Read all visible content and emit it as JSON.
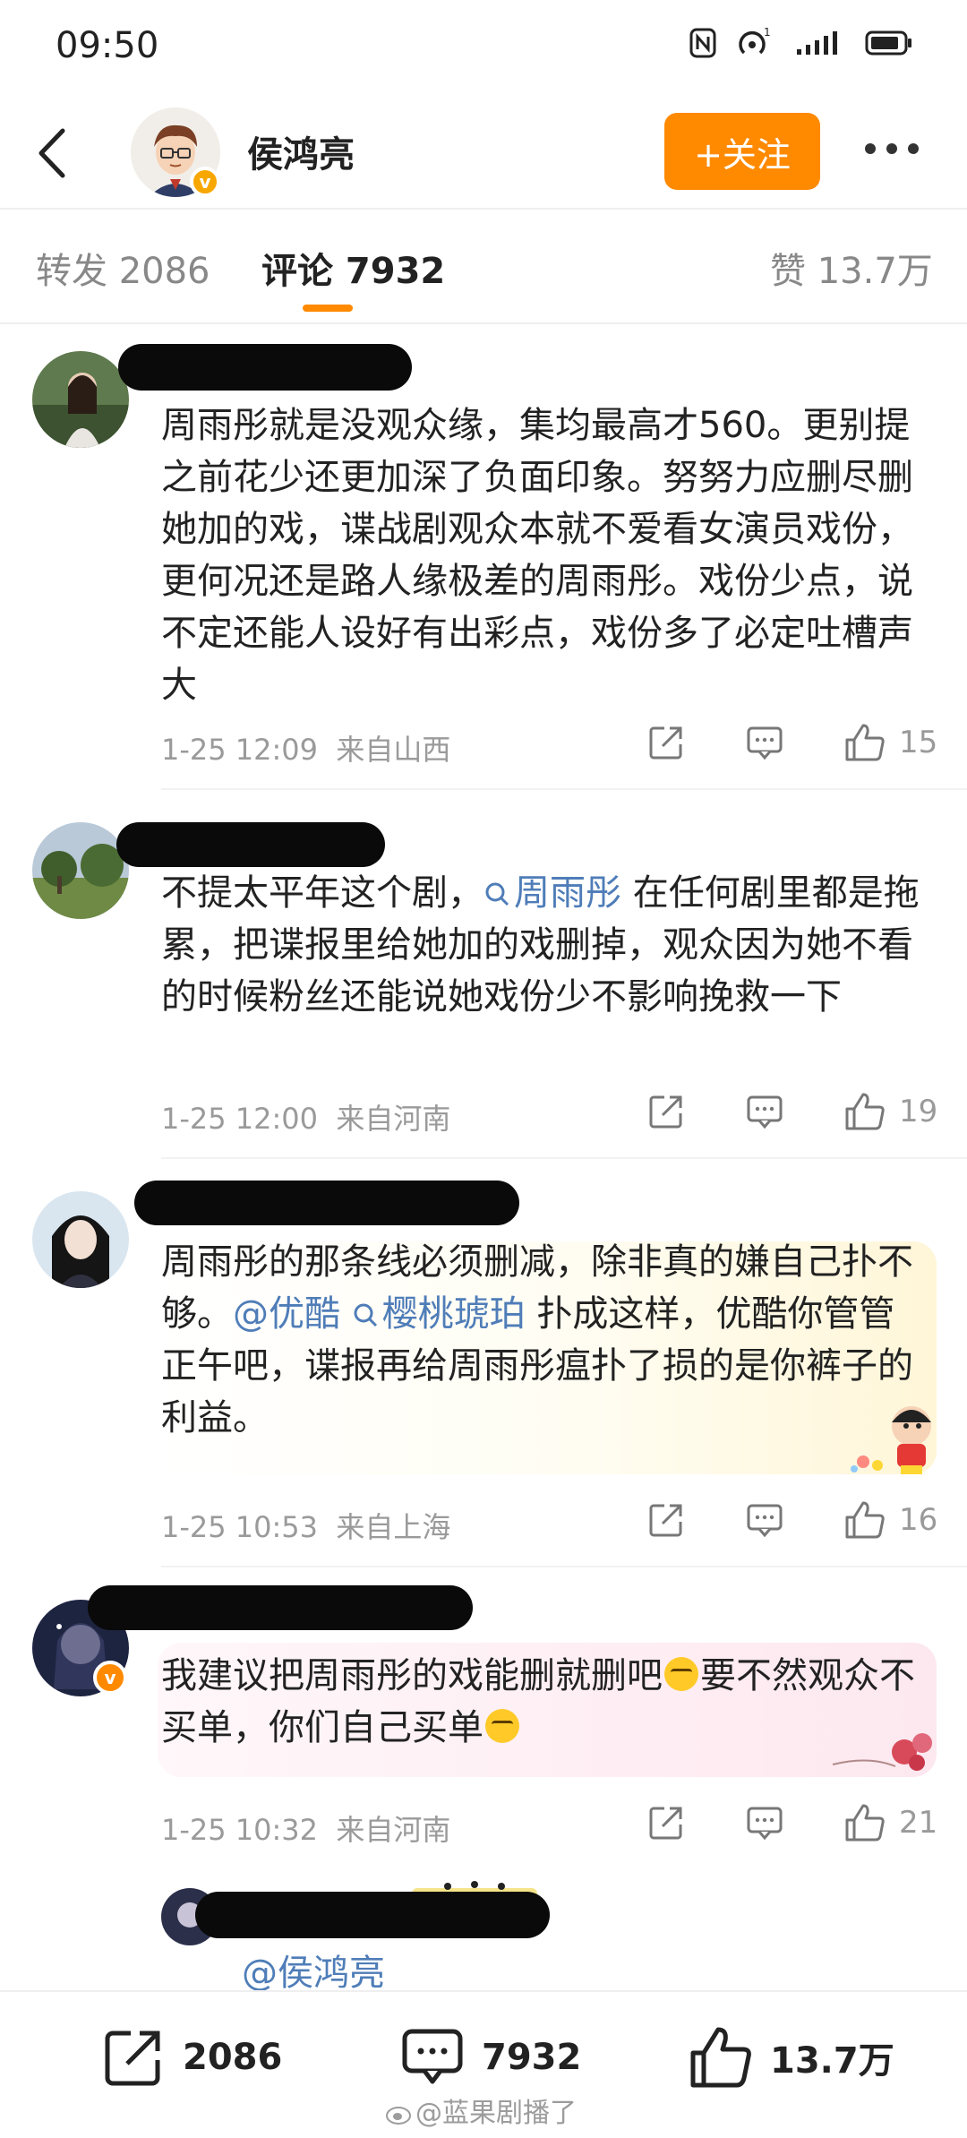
{
  "status_bar": {
    "time": "09:50"
  },
  "header": {
    "user_name": "侯鸿亮",
    "follow_label": "+关注"
  },
  "tabs": [
    {
      "label": "转发 2086"
    },
    {
      "label": "评论 7932"
    },
    {
      "label": "赞 13.7万"
    }
  ],
  "comments": [
    {
      "text": "周雨彤就是没观众缘，集均最高才560。更别提之前花少还更加深了负面印象。努努力应删尽删她加的戏，谍战剧观众本就不爱看女演员戏份，更何况还是路人缘极差的周雨彤。戏份少点，说不定还能人设好有出彩点，戏份多了必定吐槽声大",
      "time": "1-25 12:09",
      "location": "来自山西",
      "likes": "15"
    },
    {
      "text_before": "不提太平年这个剧，",
      "link1": "周雨彤",
      "text_after": " 在任何剧里都是拖累，把谍报里给她加的戏删掉，观众因为她不看的时候粉丝还能说她戏份少不影响挽救一下",
      "time": "1-25 12:00",
      "location": "来自河南",
      "likes": "19"
    },
    {
      "text_before": "周雨彤的那条线必须删减，除非真的嫌自己扑不够。",
      "mention": "@优酷",
      "link1": "樱桃琥珀",
      "text_after": " 扑成这样，优酷你管管正午吧，谍报再给周雨彤瘟扑了损的是你裤子的利益。",
      "time": "1-25 10:53",
      "location": "来自上海",
      "likes": "16"
    },
    {
      "text_before": "我建议把周雨彤的戏能删就删吧",
      "text_middle": "要不然观众不买单，你们自己买单",
      "time": "1-25 10:32",
      "location": "来自河南",
      "likes": "21"
    },
    {
      "mention": "@侯鸿亮"
    }
  ],
  "bottom_bar": {
    "reposts": "2086",
    "comments": "7932",
    "likes": "13.7万"
  },
  "watermark": "@蓝果剧播了",
  "colors": {
    "accent": "#ff8a00",
    "link": "#4f7db8",
    "meta": "#9a9a9a"
  }
}
